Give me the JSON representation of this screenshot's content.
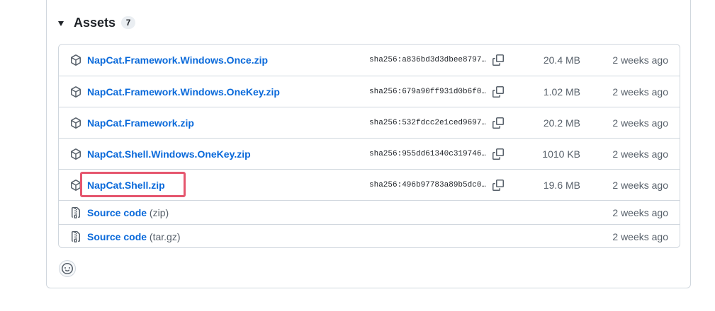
{
  "assets": {
    "title": "Assets",
    "count": "7",
    "rows": [
      {
        "name": "NapCat.Framework.Windows.Once.zip",
        "sha": "sha256:a836bd3d3dbee8797…",
        "size": "20.4 MB",
        "date": "2 weeks ago",
        "icon": "package-icon"
      },
      {
        "name": "NapCat.Framework.Windows.OneKey.zip",
        "sha": "sha256:679a90ff931d0b6f0…",
        "size": "1.02 MB",
        "date": "2 weeks ago",
        "icon": "package-icon"
      },
      {
        "name": "NapCat.Framework.zip",
        "sha": "sha256:532fdcc2e1ced9697…",
        "size": "20.2 MB",
        "date": "2 weeks ago",
        "icon": "package-icon"
      },
      {
        "name": "NapCat.Shell.Windows.OneKey.zip",
        "sha": "sha256:955dd61340c319746…",
        "size": "1010 KB",
        "date": "2 weeks ago",
        "icon": "package-icon"
      },
      {
        "name": "NapCat.Shell.zip",
        "sha": "sha256:496b97783a89b5dc0…",
        "size": "19.6 MB",
        "date": "2 weeks ago",
        "icon": "package-icon"
      },
      {
        "name": "Source code",
        "suffix": "(zip)",
        "date": "2 weeks ago",
        "icon": "file-zip-icon"
      },
      {
        "name": "Source code",
        "suffix": "(tar.gz)",
        "date": "2 weeks ago",
        "icon": "file-zip-icon"
      }
    ]
  },
  "colors": {
    "link": "#0969da",
    "muted": "#57606a",
    "border": "#d0d7de",
    "highlight": "#e5566e"
  }
}
